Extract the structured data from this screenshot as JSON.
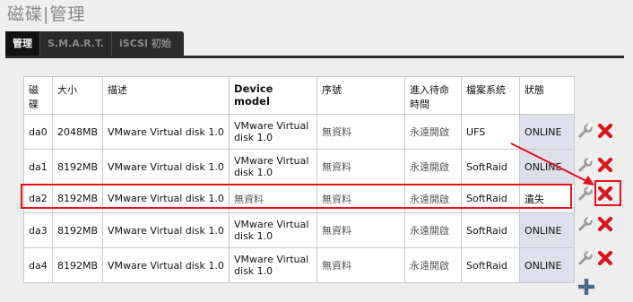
{
  "header": {
    "title": "磁碟|管理"
  },
  "tabs": [
    {
      "label": "管理",
      "active": true
    },
    {
      "label": "S.M.A.R.T.",
      "active": false
    },
    {
      "label": "iSCSI 初始",
      "active": false
    }
  ],
  "table": {
    "headers": [
      "磁碟",
      "大小",
      "描述",
      "Device model",
      "序號",
      "進入待命時間",
      "檔案系統",
      "狀態"
    ],
    "rows": [
      {
        "disk": "da0",
        "size": "2048MB",
        "desc": "VMware Virtual disk 1.0",
        "model": "VMware Virtual disk 1.0",
        "serial": "無資料",
        "standby": "永遠開啟",
        "fs": "UFS",
        "status": "ONLINE"
      },
      {
        "disk": "da1",
        "size": "8192MB",
        "desc": "VMware Virtual disk 1.0",
        "model": "VMware Virtual disk 1.0",
        "serial": "無資料",
        "standby": "永遠開啟",
        "fs": "SoftRaid",
        "status": "ONLINE"
      },
      {
        "disk": "da2",
        "size": "8192MB",
        "desc": "VMware Virtual disk 1.0",
        "model": "無資料",
        "serial": "無資料",
        "standby": "永遠開啟",
        "fs": "SoftRaid",
        "status": "遺失"
      },
      {
        "disk": "da3",
        "size": "8192MB",
        "desc": "VMware Virtual disk 1.0",
        "model": "VMware Virtual disk 1.0",
        "serial": "無資料",
        "standby": "永遠開啟",
        "fs": "SoftRaid",
        "status": "ONLINE"
      },
      {
        "disk": "da4",
        "size": "8192MB",
        "desc": "VMware Virtual disk 1.0",
        "model": "VMware Virtual disk 1.0",
        "serial": "無資料",
        "standby": "永遠開啟",
        "fs": "SoftRaid",
        "status": "ONLINE"
      }
    ]
  },
  "icons": {
    "edit": "wrench-icon",
    "delete": "delete-x-icon",
    "add": "plus-icon"
  },
  "colors": {
    "tab_bar": "#2b2b2b",
    "status_online_bg": "#dde0ec",
    "annotation_red": "#e0121a",
    "delete_red": "#d8141c",
    "add_blue": "#4a6a8a"
  }
}
